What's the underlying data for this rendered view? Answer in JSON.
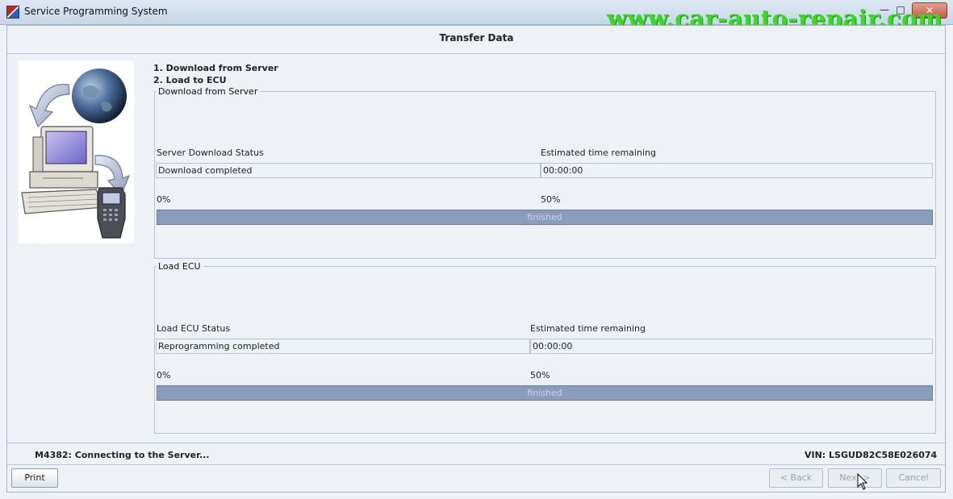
{
  "window": {
    "title": "Service Programming System",
    "minimize_glyph": "—",
    "maximize_glyph": "□",
    "close_glyph": "✕"
  },
  "watermark": "www.car-auto-repair.com",
  "page_title": "Transfer Data",
  "steps": [
    "1. Download from Server",
    "2. Load to ECU"
  ],
  "download_group": {
    "legend": "Download from Server",
    "status_label": "Server Download Status",
    "time_label": "Estimated time remaining",
    "status_value": "Download completed",
    "time_value": "00:00:00",
    "progress_min_label": "0%",
    "progress_mid_label": "50%",
    "progress_text": "finished",
    "progress_fraction": 1.0
  },
  "ecu_group": {
    "legend": "Load ECU",
    "status_label": "Load ECU Status",
    "time_label": "Estimated time remaining",
    "status_value": "Reprogramming completed",
    "time_value": "00:00:00",
    "progress_min_label": "0%",
    "progress_mid_label": "50%",
    "progress_text": "finished",
    "progress_fraction": 1.0
  },
  "status_bar": {
    "message": "M4382: Connecting to the Server...",
    "vin": "VIN: LSGUD82C58E026074"
  },
  "buttons": {
    "print": "Print",
    "back": "< Back",
    "next": "Next >",
    "cancel": "Cancel"
  },
  "colors": {
    "progress_fill": "#8b9dbd",
    "watermark": "#3bd82a",
    "background": "#eef1f6"
  }
}
